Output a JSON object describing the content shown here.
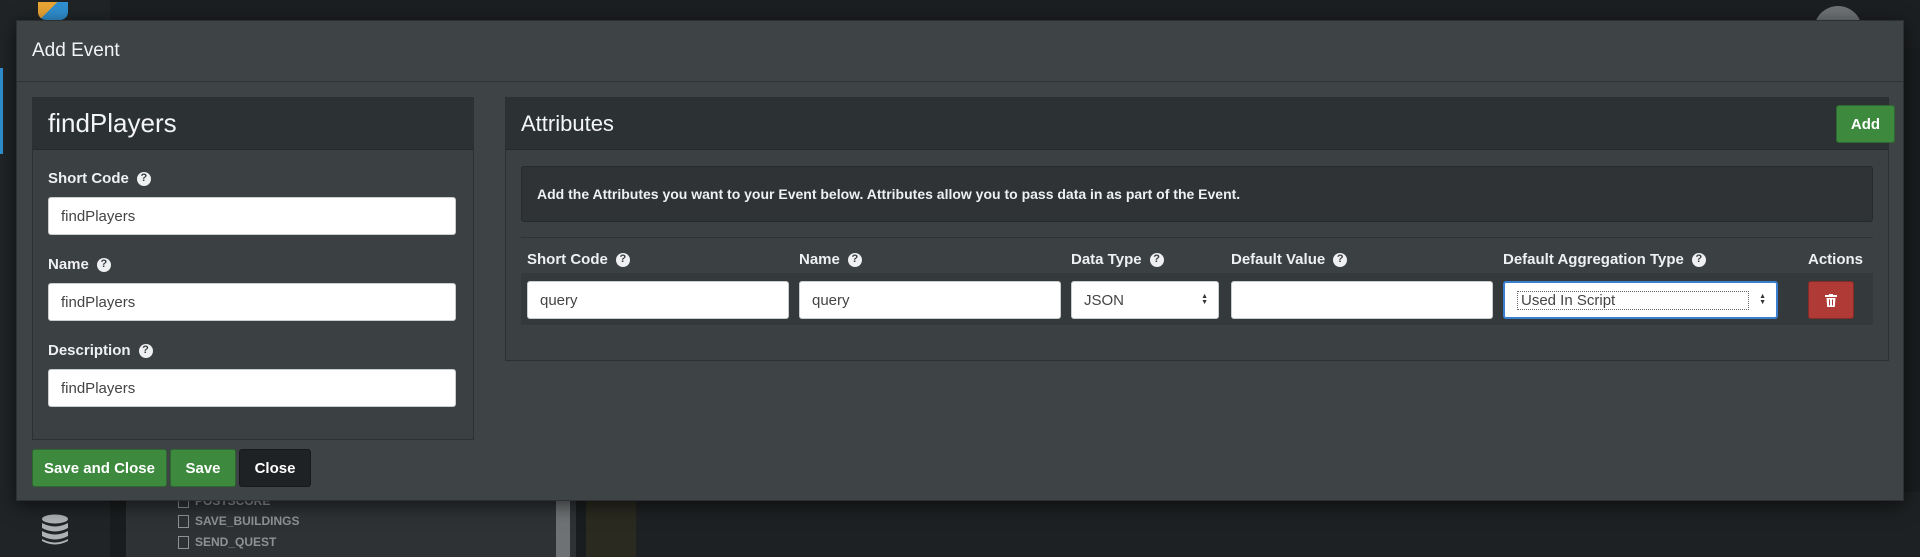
{
  "background": {
    "tree_items": [
      "POSTSCORE",
      "SAVE_BUILDINGS",
      "SEND_QUEST"
    ]
  },
  "modal": {
    "title": "Add Event",
    "left_panel": {
      "title": "findPlayers",
      "fields": {
        "short_code": {
          "label": "Short Code",
          "value": "findPlayers"
        },
        "name": {
          "label": "Name",
          "value": "findPlayers"
        },
        "description": {
          "label": "Description",
          "value": "findPlayers"
        }
      }
    },
    "right_panel": {
      "title": "Attributes",
      "add_label": "Add",
      "info": "Add the Attributes you want to your Event below. Attributes allow you to pass data in as part of the Event.",
      "columns": {
        "short_code": "Short Code",
        "name": "Name",
        "data_type": "Data Type",
        "default_value": "Default Value",
        "aggregation": "Default Aggregation Type",
        "actions": "Actions"
      },
      "rows": [
        {
          "short_code": "query",
          "name": "query",
          "data_type": "JSON",
          "default_value": "",
          "aggregation": "Used In Script"
        }
      ]
    },
    "footer": {
      "save_and_close_label": "Save and Close",
      "save_label": "Save",
      "close_label": "Close"
    }
  },
  "colors": {
    "primary_green": "#3d8a3f",
    "danger_red": "#b03a36",
    "modal_bg": "#3e4346",
    "focus_blue": "#3a7ed0"
  },
  "icons": [
    "help-icon",
    "trash-icon",
    "database-icon",
    "file-icon"
  ]
}
